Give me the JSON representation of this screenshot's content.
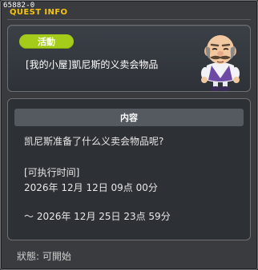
{
  "window": {
    "id_code": "65882-0",
    "title": "QUEST INFO"
  },
  "quest": {
    "category_badge": "活動",
    "name": "[我的小屋]凱尼斯的义卖会物品",
    "npc_icon": "npc-bald-mustache-man-icon"
  },
  "content": {
    "header": "内容",
    "description": "凯尼斯准备了什么义卖会物品呢?",
    "time_label": "[可执行时间]",
    "start_time": "2026年 12月 12日 09点 00分",
    "end_time": "～ 2026年 12月 25日 23点 59分"
  },
  "status": {
    "text": "狀態: 可開始"
  },
  "colors": {
    "title": "#f6c40c",
    "badge": "#a5cc1b",
    "background": "#3a3b3e"
  }
}
